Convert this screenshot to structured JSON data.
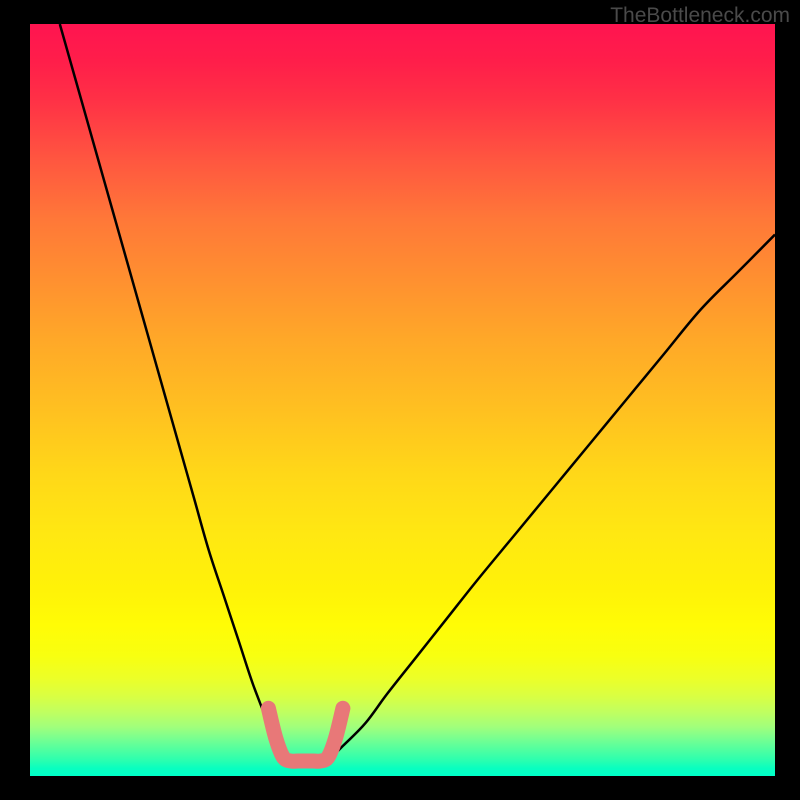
{
  "watermark": "TheBottleneck.com",
  "chart_data": {
    "type": "line",
    "title": "",
    "xlabel": "",
    "ylabel": "",
    "xlim": [
      0,
      100
    ],
    "ylim": [
      0,
      100
    ],
    "series": [
      {
        "name": "bottleneck-curve-left",
        "x": [
          4,
          6,
          8,
          10,
          12,
          14,
          16,
          18,
          20,
          22,
          24,
          26,
          28,
          30,
          32,
          33.5,
          35
        ],
        "y": [
          100,
          93,
          86,
          79,
          72,
          65,
          58,
          51,
          44,
          37,
          30,
          24,
          18,
          12,
          7,
          4,
          2
        ]
      },
      {
        "name": "bottleneck-curve-right",
        "x": [
          40,
          42,
          45,
          48,
          52,
          56,
          60,
          65,
          70,
          75,
          80,
          85,
          90,
          95,
          100
        ],
        "y": [
          2,
          4,
          7,
          11,
          16,
          21,
          26,
          32,
          38,
          44,
          50,
          56,
          62,
          67,
          72
        ]
      },
      {
        "name": "optimal-zone",
        "x": [
          32,
          33,
          34,
          35,
          36,
          37,
          38,
          39,
          40,
          41,
          42
        ],
        "y": [
          9,
          5,
          2.5,
          2,
          2,
          2,
          2,
          2,
          2.5,
          5,
          9
        ]
      }
    ],
    "annotations": []
  }
}
